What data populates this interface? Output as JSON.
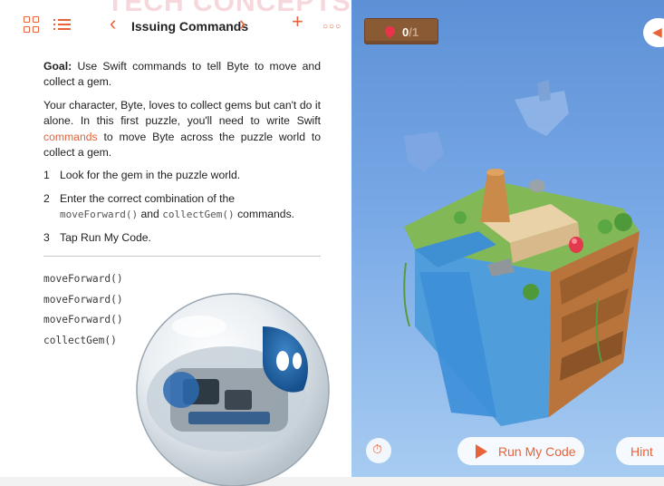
{
  "watermark": "TECH CONCEPTS",
  "nav": {
    "title": "Issuing Commands"
  },
  "lesson": {
    "goal_label": "Goal:",
    "goal_text": " Use Swift commands to tell Byte to move and collect a gem.",
    "intro_before_link": "Your character, Byte, loves to collect gems but can't do it alone. In this first puzzle, you'll need to write Swift ",
    "intro_link": "commands",
    "intro_after_link": " to move Byte across the puzzle world to collect a gem.",
    "steps": [
      {
        "num": "1",
        "text": "Look for the gem in the puzzle world."
      },
      {
        "num": "2",
        "text_before": "Enter the correct combination of the",
        "code1": "moveForward()",
        "and": " and ",
        "code2": "collectGem()",
        "text_after": " commands."
      },
      {
        "num": "3",
        "text": "Tap Run My Code."
      }
    ]
  },
  "code_editor": {
    "lines": [
      "moveForward()",
      "moveForward()",
      "moveForward()",
      "collectGem()"
    ]
  },
  "game": {
    "score_collected": "0",
    "score_total": "/1",
    "run_label": "Run My Code",
    "hint_label": "Hint",
    "accent_color": "#e8633a",
    "sky_color": "#6d9fe0"
  },
  "icons": [
    "grid-icon",
    "list-icon",
    "chevron-left-icon",
    "chevron-right-icon",
    "plus-icon",
    "more-icon",
    "gem-icon",
    "speaker-icon",
    "speed-icon",
    "play-icon"
  ]
}
